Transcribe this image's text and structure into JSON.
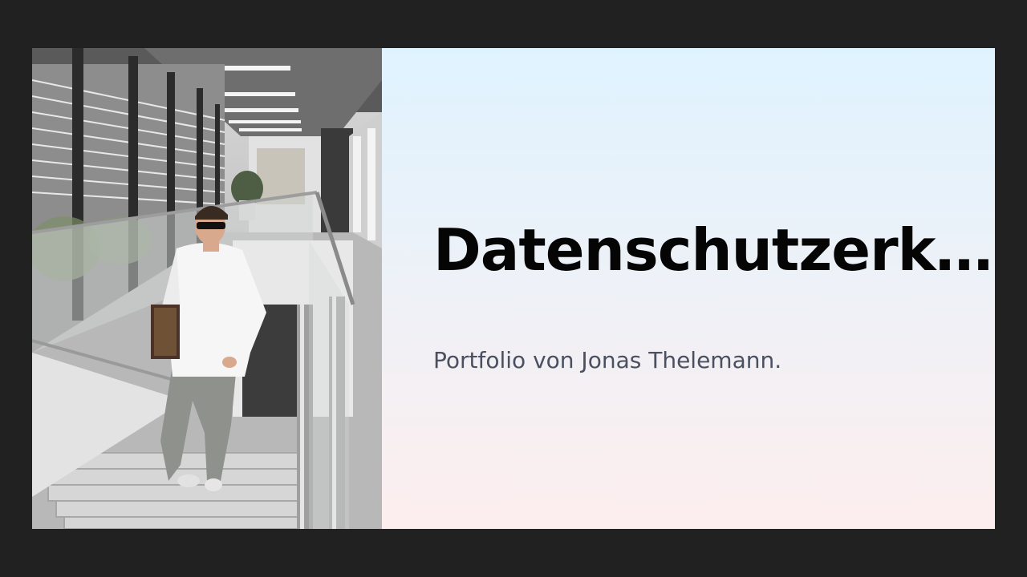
{
  "slide": {
    "title": "Datenschutzerk…",
    "subtitle": "Portfolio von Jonas Thelemann."
  },
  "colors": {
    "page_background": "#212121",
    "gradient_top": "#dff3ff",
    "gradient_bottom": "#fdeeee",
    "title_color": "#050505",
    "subtitle_color": "#4a5060"
  }
}
